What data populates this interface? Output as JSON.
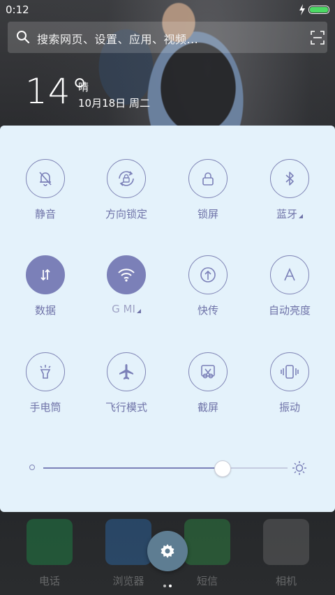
{
  "status": {
    "time": "0:12",
    "battery_level": 1.0
  },
  "search": {
    "placeholder": "搜索网页、设置、应用、视频..."
  },
  "weather": {
    "temperature": "14°",
    "condition": "晴",
    "date": "10月18日 周二"
  },
  "toggles": [
    {
      "id": "mute",
      "label": "静音",
      "icon": "bell-off-icon",
      "active": false
    },
    {
      "id": "rotation-lock",
      "label": "方向锁定",
      "icon": "rotation-lock-icon",
      "active": false
    },
    {
      "id": "lock-screen",
      "label": "锁屏",
      "icon": "lock-icon",
      "active": false
    },
    {
      "id": "bluetooth",
      "label": "蓝牙",
      "icon": "bluetooth-icon",
      "active": false,
      "has_menu": true
    },
    {
      "id": "data",
      "label": "数据",
      "icon": "data-arrows-icon",
      "active": true
    },
    {
      "id": "wifi",
      "label": "G MI",
      "icon": "wifi-icon",
      "active": true,
      "has_menu": true
    },
    {
      "id": "fast-transfer",
      "label": "快传",
      "icon": "upload-icon",
      "active": false
    },
    {
      "id": "auto-brightness",
      "label": "自动亮度",
      "icon": "auto-brightness-icon",
      "active": false
    },
    {
      "id": "flashlight",
      "label": "手电筒",
      "icon": "flashlight-icon",
      "active": false
    },
    {
      "id": "airplane",
      "label": "飞行模式",
      "icon": "airplane-icon",
      "active": false
    },
    {
      "id": "screenshot",
      "label": "截屏",
      "icon": "scissors-icon",
      "active": false
    },
    {
      "id": "vibrate",
      "label": "振动",
      "icon": "vibrate-icon",
      "active": false
    }
  ],
  "brightness": {
    "level": 0.73
  },
  "dock": [
    {
      "label": "电话",
      "icon": "phone-app-icon",
      "color": "#1aa851"
    },
    {
      "label": "浏览器",
      "icon": "browser-app-icon",
      "color": "#2f7fd0"
    },
    {
      "label": "短信",
      "icon": "messages-app-icon",
      "color": "#2ea84a"
    },
    {
      "label": "相机",
      "icon": "camera-app-icon",
      "color": "#7c7c7c"
    }
  ],
  "colors": {
    "accent": "#7b80b8",
    "panel": "#e4f2fb",
    "battery": "#4cd964"
  }
}
